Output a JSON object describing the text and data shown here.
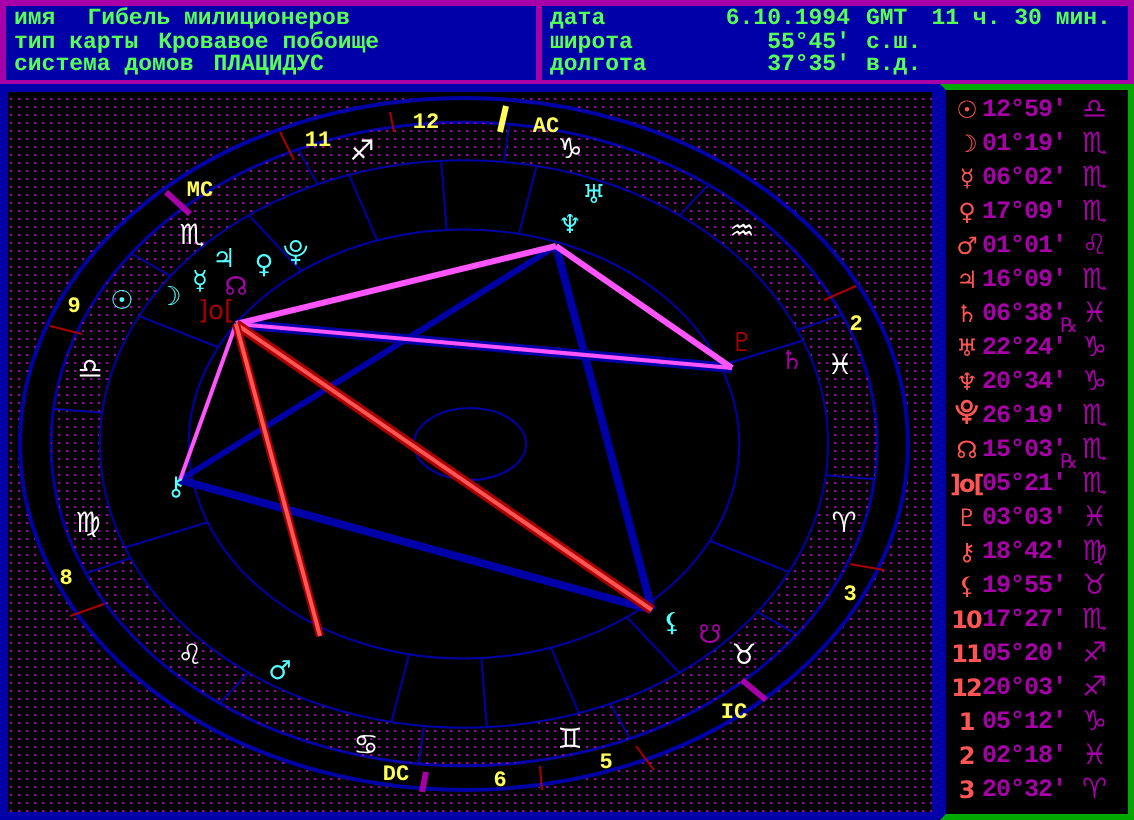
{
  "header": {
    "left_rows": [
      {
        "label": "имя",
        "value": "Гибель милиционеров"
      },
      {
        "label": "тип карты",
        "value": "Кровавое побоище"
      },
      {
        "label": "система домов",
        "value": "ПЛАЦИДУС"
      }
    ],
    "right_rows": [
      {
        "label": "дата",
        "value": "6.10.1994",
        "zone": "GMT",
        "time": "11 ч. 30 мин."
      },
      {
        "label": "широта",
        "value": "55°45′",
        "suffix": "с.ш."
      },
      {
        "label": "долгота",
        "value": "37°35′",
        "suffix": "в.д."
      }
    ]
  },
  "chart": {
    "signs": [
      "♈",
      "♉",
      "♊",
      "♋",
      "♌",
      "♍",
      "♎",
      "♏",
      "♐",
      "♑",
      "♒",
      "♓"
    ],
    "house_numbers": [
      "2",
      "3",
      "5",
      "6",
      "8",
      "9",
      "11",
      "12"
    ],
    "angle_labels": [
      "AC",
      "MC",
      "DC",
      "IC"
    ],
    "planets": [
      {
        "glyph": "☉",
        "color": "#55ffff"
      },
      {
        "glyph": "☽",
        "color": "#55ffff"
      },
      {
        "glyph": "☿",
        "color": "#55ffff"
      },
      {
        "glyph": "♃",
        "color": "#55ffff"
      },
      {
        "glyph": "♀",
        "color": "#55ffff"
      },
      {
        "glyph": "⯓",
        "color": "#55ffff"
      },
      {
        "glyph": "☊",
        "color": "#a800a8"
      },
      {
        "glyph": "]o[",
        "color": "#a80000"
      },
      {
        "glyph": "♅",
        "color": "#55ffff"
      },
      {
        "glyph": "♆",
        "color": "#55ffff"
      },
      {
        "glyph": "♇",
        "color": "#a80000"
      },
      {
        "glyph": "♄",
        "color": "#a800a8"
      },
      {
        "glyph": "⚷",
        "color": "#55ffff"
      },
      {
        "glyph": "♂",
        "color": "#55ffff"
      },
      {
        "glyph": "⚸",
        "color": "#55ffff"
      },
      {
        "glyph": "☋",
        "color": "#a800a8"
      }
    ]
  },
  "positions": [
    {
      "glyph": "☉",
      "degree": "12°59′",
      "sign": "♎"
    },
    {
      "glyph": "☽",
      "degree": "01°19′",
      "sign": "♏"
    },
    {
      "glyph": "☿",
      "degree": "06°02′",
      "sign": "♏"
    },
    {
      "glyph": "♀",
      "degree": "17°09′",
      "sign": "♏"
    },
    {
      "glyph": "♂",
      "degree": "01°01′",
      "sign": "♌"
    },
    {
      "glyph": "♃",
      "degree": "16°09′",
      "sign": "♏"
    },
    {
      "glyph": "♄",
      "degree": "06°38′",
      "retro": "℞",
      "sign": "♓"
    },
    {
      "glyph": "♅",
      "degree": "22°24′",
      "sign": "♑"
    },
    {
      "glyph": "♆",
      "degree": "20°34′",
      "sign": "♑"
    },
    {
      "glyph": "⯓",
      "degree": "26°19′",
      "sign": "♏"
    },
    {
      "glyph": "☊",
      "degree": "15°03′",
      "retro": "℞",
      "sign": "♏"
    },
    {
      "glyph": "]o[",
      "degree": "05°21′",
      "sign": "♏"
    },
    {
      "glyph": "♇",
      "degree": "03°03′",
      "sign": "♓"
    },
    {
      "glyph": "⚷",
      "degree": "18°42′",
      "sign": "♍"
    },
    {
      "glyph": "⚸",
      "degree": "19°55′",
      "sign": "♉"
    },
    {
      "glyph": "10",
      "degree": "17°27′",
      "sign": "♏"
    },
    {
      "glyph": "11",
      "degree": "05°20′",
      "sign": "♐"
    },
    {
      "glyph": "12",
      "degree": "20°03′",
      "sign": "♐"
    },
    {
      "glyph": "1",
      "degree": "05°12′",
      "sign": "♑"
    },
    {
      "glyph": "2",
      "degree": "02°18′",
      "sign": "♓"
    },
    {
      "glyph": "3",
      "degree": "20°32′",
      "sign": "♈"
    }
  ]
}
